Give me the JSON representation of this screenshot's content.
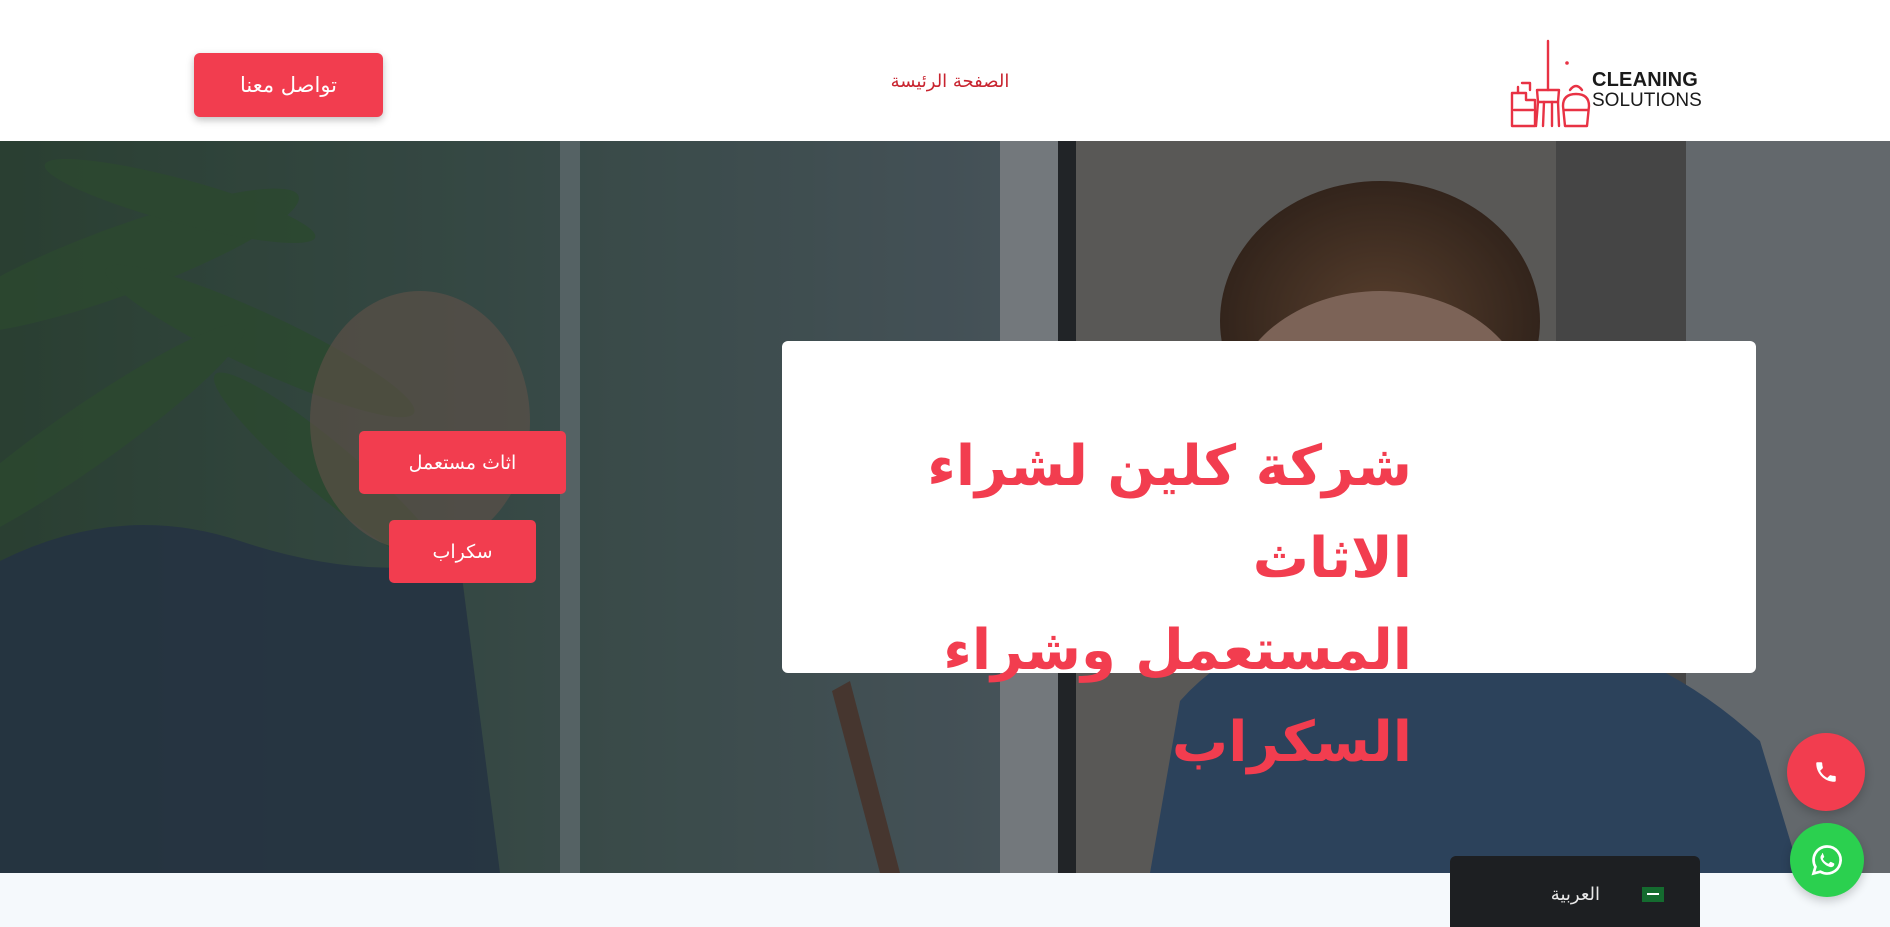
{
  "header": {
    "logo": {
      "line1": "CLEANING",
      "line2": "SOLUTIONS"
    },
    "nav_home": "الصفحة الرئيسة",
    "contact_button": "تواصل معنا"
  },
  "hero": {
    "title_line1": "شركة كلين لشراء الاثاث",
    "title_line2": "المستعمل وشراء السكراب",
    "buttons": {
      "used_furniture": "اثاث مستعمل",
      "scrap": "سكراب"
    }
  },
  "floating": {
    "phone_icon": "phone-icon",
    "whatsapp_icon": "whatsapp-icon"
  },
  "language": {
    "label": "العربية",
    "flag": "saudi-flag-icon"
  },
  "colors": {
    "accent": "#f23d4f",
    "nav_link": "#c8242f",
    "whatsapp": "#2bd04f",
    "lang_bg": "#1d1f22"
  }
}
